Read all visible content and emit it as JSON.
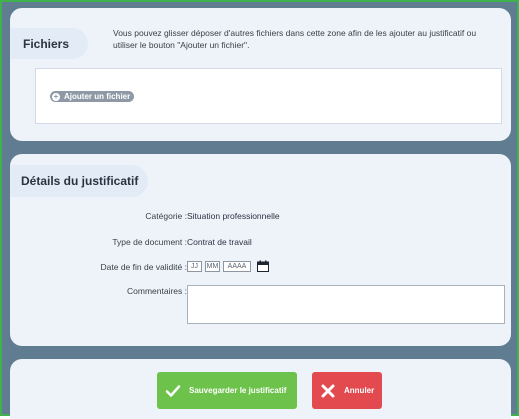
{
  "files": {
    "title": "Fichiers",
    "info": "Vous pouvez glisser déposer d'autres fichiers dans cette zone afin de les ajouter au justificatif ou utiliser le bouton \"Ajouter un fichier\".",
    "add_button": "Ajouter un fichier"
  },
  "details": {
    "title": "Détails du justificatif",
    "category_label": "Catégorie :",
    "category_value": "Situation professionnelle",
    "doc_type_label": "Type de document :",
    "doc_type_value": "Contrat de travail",
    "validity_label": "Date de fin de validité :",
    "date_day_placeholder": "JJ",
    "date_month_placeholder": "MM",
    "date_year_placeholder": "AAAA",
    "comments_label": "Commentaires :",
    "comments_value": ""
  },
  "actions": {
    "save_label": "Sauvegarder le justificatif",
    "cancel_label": "Annuler"
  },
  "colors": {
    "save": "#6cc24a",
    "cancel": "#e34a4f",
    "background": "#5f7c91",
    "panel": "#eef3fa"
  },
  "icons": {
    "add": "plus-circle-icon",
    "calendar": "calendar-icon",
    "save": "checkmark-icon",
    "cancel": "x-icon"
  }
}
